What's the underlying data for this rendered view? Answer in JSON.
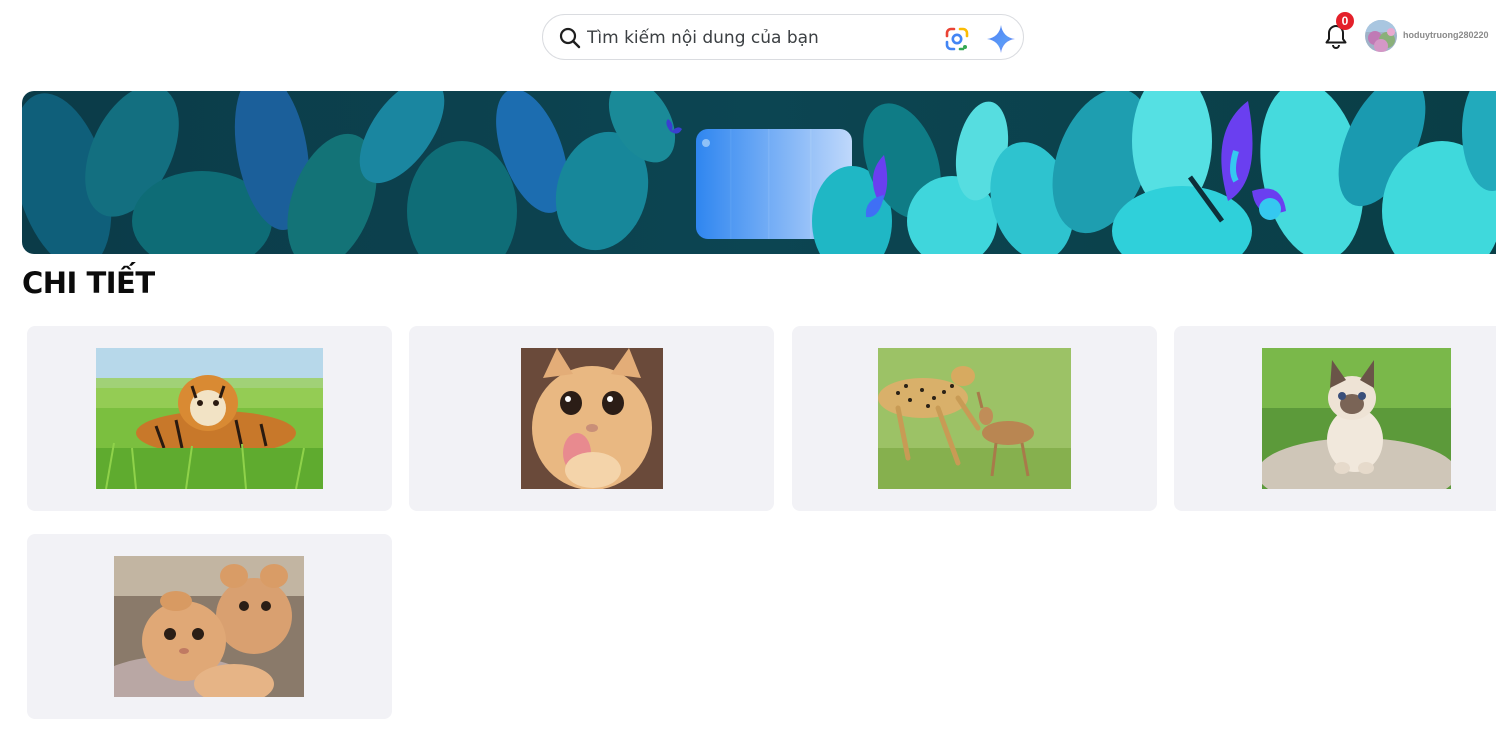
{
  "header": {
    "search": {
      "placeholder": "Tìm kiếm nội dung của bạn",
      "value": "",
      "icons": [
        "search-icon",
        "google-lens-icon",
        "ai-sparkle-icon"
      ]
    },
    "notifications": {
      "icon": "bell-icon",
      "count": "0"
    },
    "user": {
      "name": "hoduytruong280220",
      "avatar": "avatar"
    }
  },
  "banner": {
    "theme": "teal leaves and butterflies illustration"
  },
  "section": {
    "title": "CHI TIẾT"
  },
  "gallery": [
    {
      "subject": "tiger-photo"
    },
    {
      "subject": "cat-licking-photo"
    },
    {
      "subject": "cheetah-gazelle-photo"
    },
    {
      "subject": "kitten-photo"
    },
    {
      "subject": "two-cats-photo"
    }
  ],
  "colors": {
    "badge": "#e4202a",
    "card_bg": "#f2f2f6",
    "banner_dark": "#0d3f4c",
    "banner_light": "#3fd9dc"
  }
}
